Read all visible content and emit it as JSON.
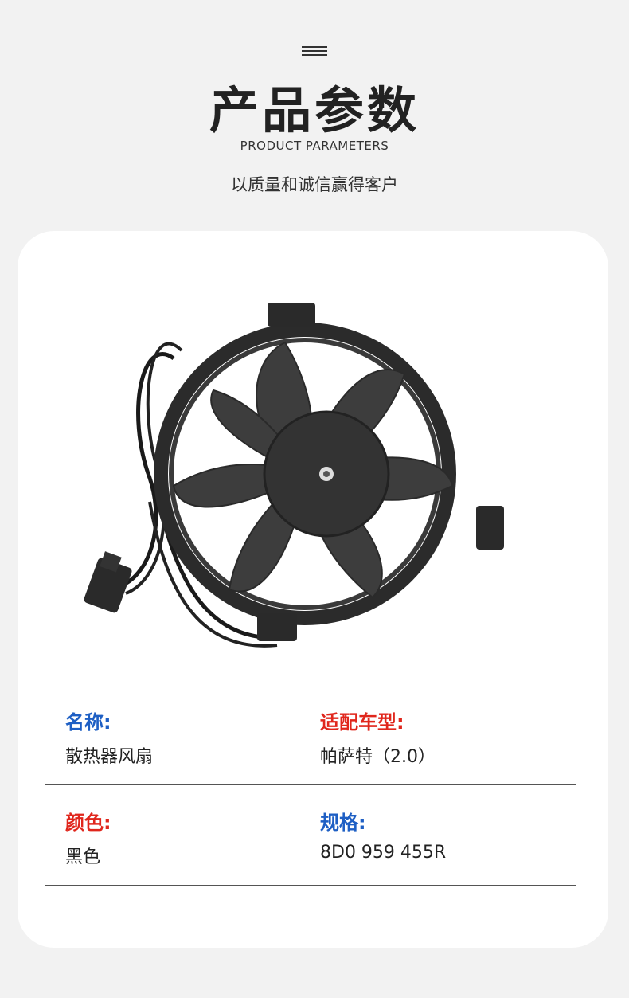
{
  "header": {
    "title": "产品参数",
    "subtitle_en": "PRODUCT PARAMETERS",
    "slogan": "以质量和诚信赢得客户"
  },
  "specs": {
    "name": {
      "label": "名称:",
      "value": "散热器风扇",
      "color": "#1e5fc4"
    },
    "vehicle": {
      "label": "适配车型:",
      "value": "帕萨特（2.0）",
      "color": "#e0261c"
    },
    "color": {
      "label": "颜色:",
      "value": "黑色",
      "color": "#e0261c"
    },
    "model": {
      "label": "规格:",
      "value": "8D0 959 455R",
      "color": "#1e5fc4"
    }
  },
  "colors": {
    "background": "#f2f2f2",
    "card": "#ffffff",
    "blue": "#1e5fc4",
    "red": "#e0261c"
  }
}
